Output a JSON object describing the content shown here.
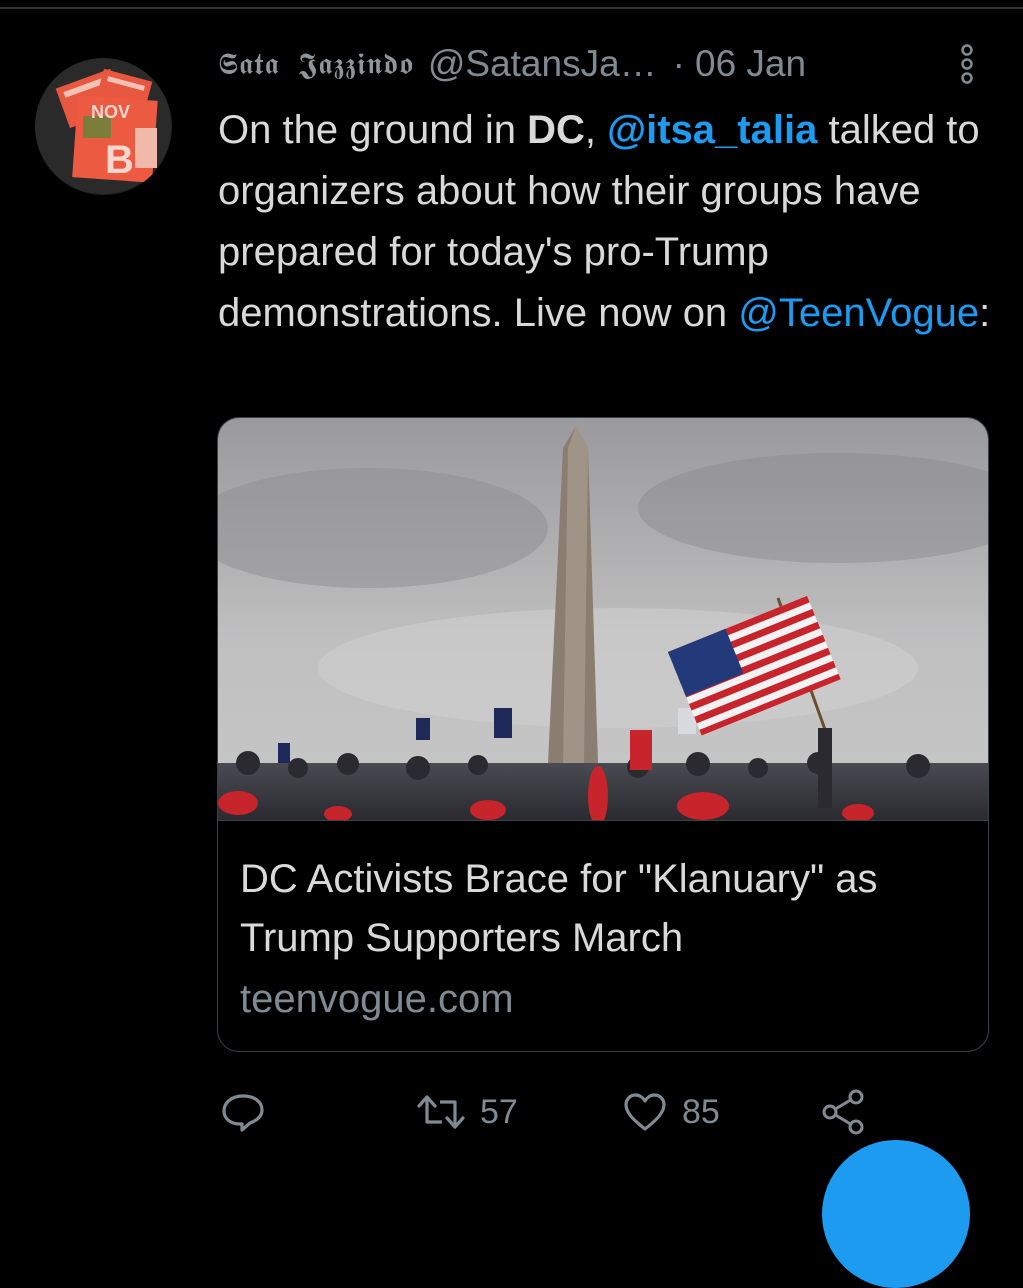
{
  "tweet": {
    "display_name": "𝕾𝖆𝖙𝖆 𝕵𝖆𝖟𝖟𝖎𝖓𝖉𝖔",
    "handle": "@SatansJa…",
    "separator": "·",
    "date": "06 Jan",
    "text": {
      "p1": "On the ground in ",
      "p2": "DC",
      "p3": ", ",
      "mention1": "@itsa_talia",
      "p4": " talked to organizers about how their groups have prepared for today's pro-Trump demonstrations. Live now on ",
      "mention2": "@TeenVogue",
      "p5": ":"
    }
  },
  "card": {
    "title": "DC Activists Brace for \"Klanuary\" as Trump Supporters March",
    "domain": "teenvogue.com"
  },
  "actions": {
    "reply_icon": "reply-icon",
    "retweet_icon": "retweet-icon",
    "retweet_count": "57",
    "like_icon": "heart-icon",
    "like_count": "85",
    "share_icon": "share-icon"
  },
  "colors": {
    "background": "#000000",
    "text": "#d9d9d9",
    "muted": "#7f8a93",
    "accent": "#1d9bf0",
    "border": "#38444d"
  }
}
